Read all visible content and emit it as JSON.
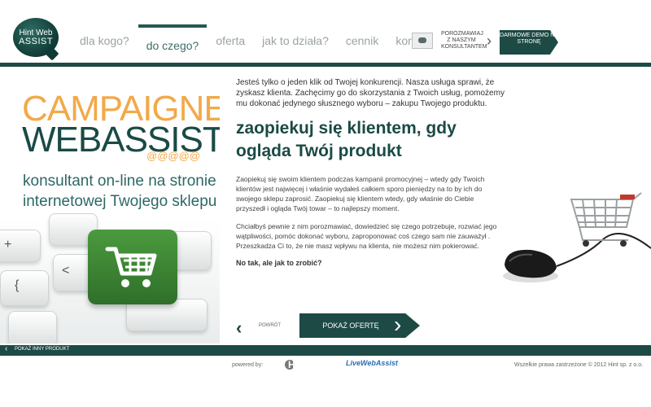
{
  "logo": {
    "line1": "Hint Web",
    "line2": "ASSIST"
  },
  "nav": {
    "items": [
      "dla kogo?",
      "do czego?",
      "oferta",
      "jak to działa?",
      "cennik",
      "kontakt"
    ]
  },
  "chat": {
    "text": "POROZMAWIAJ Z NASZYM KONSULTANTEM"
  },
  "demo": {
    "label": "DARMOWE DEMO NA STRONĘ"
  },
  "promo": {
    "title1": "CAMPAIGNE",
    "title2": "WEBASSIST",
    "at": "@@@@@",
    "subtitle": "konsultant on-line na stronie internetowej Twojego sklepu"
  },
  "main": {
    "intro": "Jesteś tylko o jeden klik od Twojej konkurencji. Nasza usługa sprawi, że zyskasz klienta. Zachęcimy go do skorzystania z Twoich usług, pomożemy mu dokonać jedynego słusznego wyboru – zakupu Twojego produktu.",
    "headline": "zaopiekuj się klientem, gdy ogląda Twój produkt",
    "para1": "Zaopiekuj się swoim klientem podczas kampanii promocyjnej – wtedy gdy Twoich klientów jest najwięcej i właśnie wydałeś całkiem sporo pieniędzy na to by ich do swojego sklepu zaprosić. Zaopiekuj się klientem wtedy, gdy właśnie do Ciebie przyszedł i ogląda Twój towar – to najlepszy moment.",
    "para2": "Chciałbyś pewnie z nim porozmawiać, dowiedzieć się czego potrzebuje, rozwiać jego wątpliwości, pomóc dokonać wyboru, zaproponować coś czego sam nie zauważył . Przeszkadza Ci to, że nie masz wpływu na klienta, nie możesz nim pokierować.",
    "question": "No tak, ale jak to zrobić?"
  },
  "actions": {
    "back": "POWRÓT",
    "cta": "POKAŻ OFERTĘ"
  },
  "bottom": {
    "other_product": "POKAŻ INNY PRODUKT"
  },
  "footer": {
    "powered": "powered by:",
    "hint": "HINT",
    "lwa": "LiveWebAssist",
    "copyright": "Wszelkie prawa zastrzeżone © 2012 Hint sp. z o.o."
  },
  "colors": {
    "brand": "#1d4a45",
    "accent": "#f2a94a",
    "keyboard_green": "#3f8a36"
  }
}
